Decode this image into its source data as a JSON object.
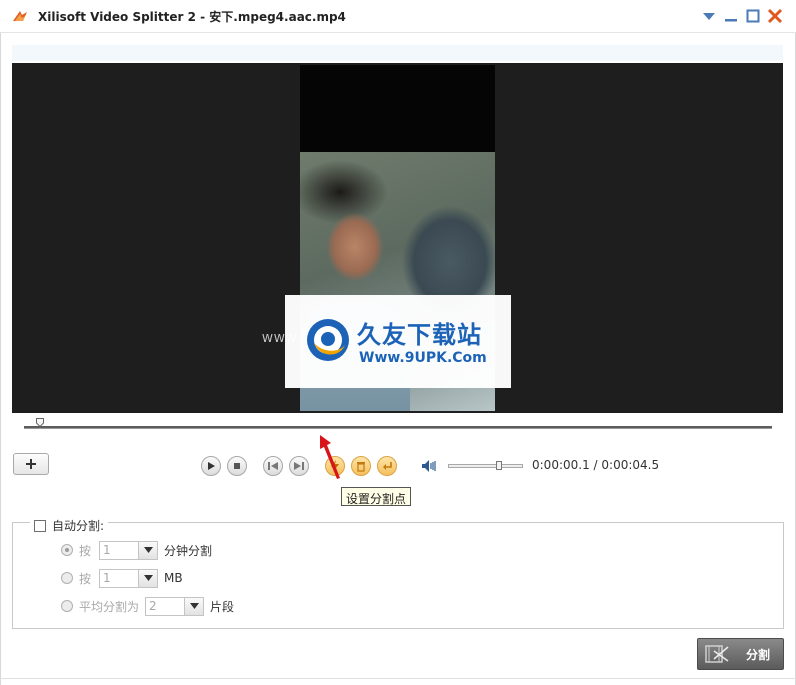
{
  "window": {
    "title": "Xilisoft Video Splitter 2 - 安下.mpeg4.aac.mp4",
    "controls": [
      "menu-dropdown-icon",
      "minimize-icon",
      "maximize-icon",
      "close-icon"
    ],
    "close_color": "#e05a1c"
  },
  "video": {
    "background": "#1e1e1e",
    "watermark": {
      "title": "久友下载站",
      "url": "Www.9UPK.Com",
      "left_url": "WWW.9UPK.COM"
    }
  },
  "controls": {
    "add_label": "+",
    "play": "play-icon",
    "stop": "stop-icon",
    "prev": "previous-icon",
    "next": "next-icon",
    "set_split": "split-point-icon",
    "delete": "delete-icon",
    "undo": "undo-icon",
    "volume": "volume-icon",
    "volume_level": 0.7,
    "time_current": "0:00:00.1",
    "time_separator": "/",
    "time_total": "0:00:04.5",
    "tooltip": "设置分割点"
  },
  "auto_split": {
    "label": "自动分割:",
    "checked": false,
    "options": [
      {
        "prefix": "按",
        "value": "1",
        "unit": "分钟分割",
        "selected": true
      },
      {
        "prefix": "按",
        "value": "1",
        "unit": "MB",
        "selected": false
      },
      {
        "prefix": "平均分割为",
        "value": "2",
        "unit": "片段",
        "selected": false
      }
    ]
  },
  "split_button": {
    "label": "分割"
  }
}
